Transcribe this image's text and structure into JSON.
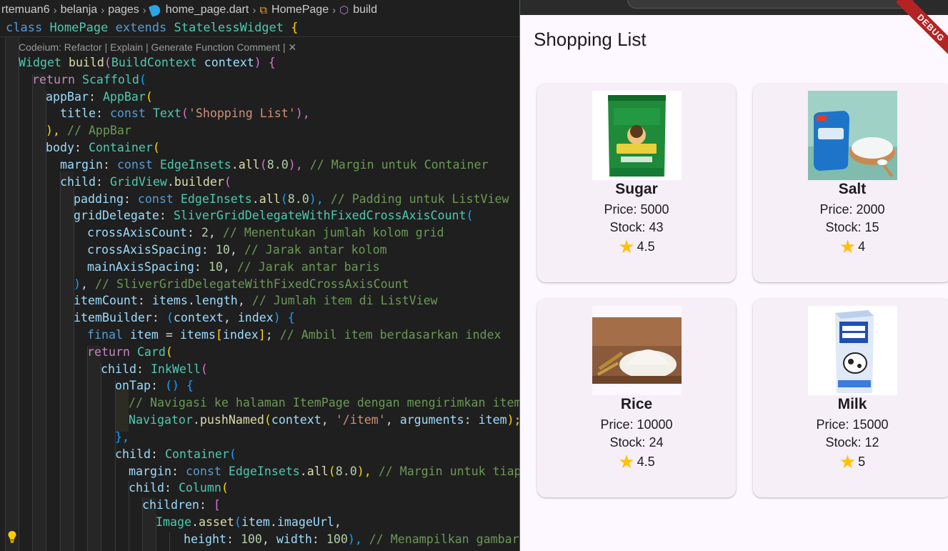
{
  "editor": {
    "breadcrumb": {
      "items": [
        "rtemuan6",
        "belanja",
        "pages",
        "home_page.dart",
        "HomePage",
        "build"
      ]
    },
    "sticky_line": [
      "class",
      "HomePage",
      "extends",
      "StatelessWidget",
      "{"
    ],
    "codelens": "Codeium: Refactor | Explain | Generate Function Comment | ✕",
    "code": {
      "l1": [
        "Widget",
        "build",
        "(",
        "BuildContext",
        "context",
        ")",
        "{"
      ],
      "l2": [
        "return",
        "Scaffold",
        "("
      ],
      "l3": [
        "appBar",
        ": ",
        "AppBar",
        "("
      ],
      "l4": [
        "title",
        ": ",
        "const",
        "Text",
        "(",
        "'Shopping List'",
        "),"
      ],
      "l5": [
        "),",
        " // AppBar"
      ],
      "l6": [
        "body",
        ": ",
        "Container",
        "("
      ],
      "l7": [
        "margin",
        ": ",
        "const",
        "EdgeInsets",
        ".",
        "all",
        "(",
        "8.0",
        "),",
        " // Margin untuk Container"
      ],
      "l8": [
        "child",
        ": ",
        "GridView",
        ".",
        "builder",
        "("
      ],
      "l9": [
        "padding",
        ": ",
        "const",
        "EdgeInsets",
        ".",
        "all",
        "(",
        "8.0",
        "),",
        " // Padding untuk ListView"
      ],
      "l10": [
        "gridDelegate",
        ": ",
        "SliverGridDelegateWithFixedCrossAxisCount",
        "("
      ],
      "l11": [
        "crossAxisCount",
        ": ",
        "2",
        ",",
        " // Menentukan jumlah kolom grid"
      ],
      "l12": [
        "crossAxisSpacing",
        ": ",
        "10",
        ",",
        " // Jarak antar kolom"
      ],
      "l13": [
        "mainAxisSpacing",
        ": ",
        "10",
        ",",
        " // Jarak antar baris"
      ],
      "l14": [
        ")",
        ",",
        " // SliverGridDelegateWithFixedCrossAxisCount"
      ],
      "l15": [
        "itemCount",
        ": ",
        "items",
        ".",
        "length",
        ",",
        " // Jumlah item di ListView"
      ],
      "l16": [
        "itemBuilder",
        ": ",
        "(",
        "context",
        ", ",
        "index",
        ")",
        " {"
      ],
      "l17": [
        "final",
        " item",
        " = ",
        "items",
        "[",
        "index",
        "]",
        ";",
        " // Ambil item berdasarkan index"
      ],
      "l18": [
        "return",
        " Card",
        "("
      ],
      "l19": [
        "child",
        ": ",
        "InkWell",
        "("
      ],
      "l20": [
        "onTap",
        ": ",
        "()",
        " {"
      ],
      "l21": [
        "// Navigasi ke halaman ItemPage dengan mengirimkan item s"
      ],
      "l22": [
        "Navigator",
        ".",
        "pushNamed",
        "(",
        "context",
        ", ",
        "'/item'",
        ", ",
        "arguments",
        ": ",
        "item",
        ");"
      ],
      "l23": [
        "},"
      ],
      "l24": [
        "child",
        ": ",
        "Container",
        "("
      ],
      "l25": [
        "margin",
        ": ",
        "const",
        "EdgeInsets",
        ".",
        "all",
        "(",
        "8.0",
        "),",
        " // Margin untuk tiap i"
      ],
      "l26": [
        "child",
        ": ",
        "Column",
        "("
      ],
      "l27": [
        "children",
        ": ",
        "["
      ],
      "l28": [
        "Image",
        ".",
        "asset",
        "(",
        "item",
        ".",
        "imageUrl",
        ","
      ],
      "l29": [
        "height",
        ": ",
        "100",
        ", ",
        "width",
        ": ",
        "100",
        "),",
        " // Menampilkan gambar p"
      ]
    }
  },
  "app": {
    "title": "Shopping List",
    "debug_banner": "DEBUG",
    "items": [
      {
        "name": "Sugar",
        "price": "Price: 5000",
        "stock": "Stock: 43",
        "rating": "4.5"
      },
      {
        "name": "Salt",
        "price": "Price: 2000",
        "stock": "Stock: 15",
        "rating": "4"
      },
      {
        "name": "Rice",
        "price": "Price: 10000",
        "stock": "Stock: 24",
        "rating": "4.5"
      },
      {
        "name": "Milk",
        "price": "Price: 15000",
        "stock": "Stock: 12",
        "rating": "5"
      }
    ]
  },
  "colors": {
    "editor_bg": "#1f1f1f",
    "app_bg": "#fdf7ff",
    "card_bg": "#f6eff8",
    "star": "#ffc107"
  }
}
